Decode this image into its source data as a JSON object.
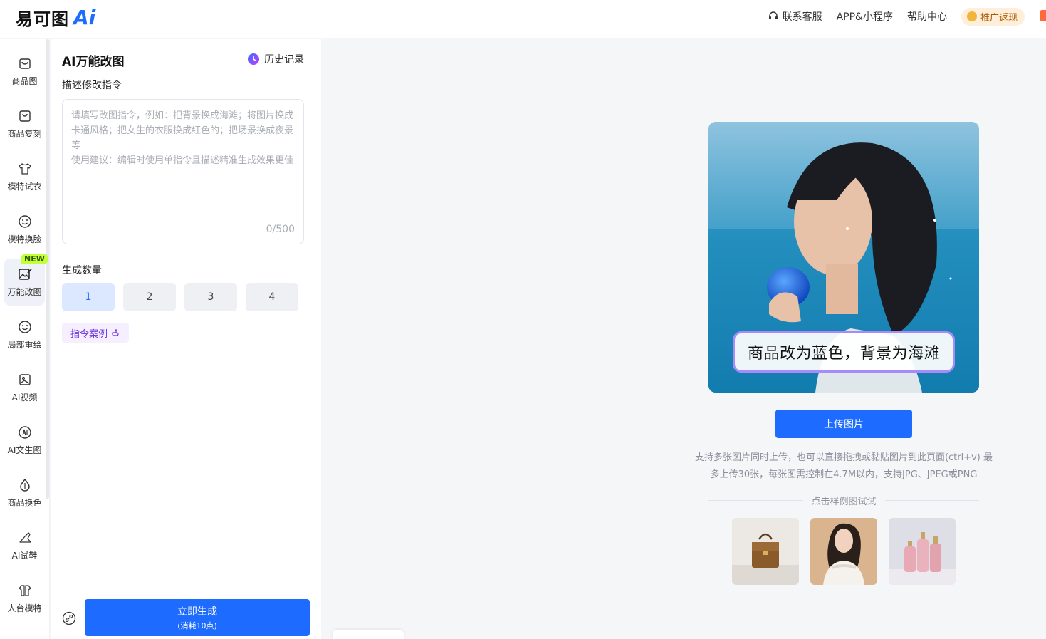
{
  "header": {
    "logo_text": "易可图",
    "logo_ai": "Ai",
    "nav": {
      "support": "联系客服",
      "app": "APP&小程序",
      "help": "帮助中心",
      "promo": "推广返现"
    }
  },
  "rail": {
    "new_badge": "NEW",
    "items": [
      {
        "label": "商品图"
      },
      {
        "label": "商品复刻"
      },
      {
        "label": "模特试衣"
      },
      {
        "label": "模特换脸"
      },
      {
        "label": "万能改图"
      },
      {
        "label": "局部重绘"
      },
      {
        "label": "AI视频"
      },
      {
        "label": "AI文生图"
      },
      {
        "label": "商品换色"
      },
      {
        "label": "AI试鞋"
      },
      {
        "label": "人台模特"
      }
    ]
  },
  "panel": {
    "title": "AI万能改图",
    "history": "历史记录",
    "prompt_label": "描述修改指令",
    "prompt_placeholder": "请填写改图指令，例如：把背景换成海滩；将图片换成卡通风格；把女生的衣服换成红色的；把场景换成夜景等\n使用建议：编辑时使用单指令且描述精准生成效果更佳",
    "prompt_value": "",
    "counter": "0/500",
    "count_label": "生成数量",
    "count_options": [
      "1",
      "2",
      "3",
      "4"
    ],
    "selected_count": "1",
    "examples_button": "指令案例",
    "generate_main": "立即生成",
    "generate_sub": "(消耗10点)"
  },
  "main": {
    "hero_caption": "商品改为蓝色，背景为海滩",
    "upload_button": "上传图片",
    "upload_hint_line1": "支持多张图片同时上传，也可以直接拖拽或黏贴图片到此页面(ctrl+v) 最",
    "upload_hint_line2": "多上传30张，每张图需控制在4.7M以内，支持JPG、JPEG或PNG",
    "sample_title": "点击样例图试试"
  },
  "colors": {
    "primary": "#1e6bff",
    "selected_bg": "#dce8ff",
    "new_badge": "#c6ff3a",
    "examples_text": "#6b32d6"
  }
}
